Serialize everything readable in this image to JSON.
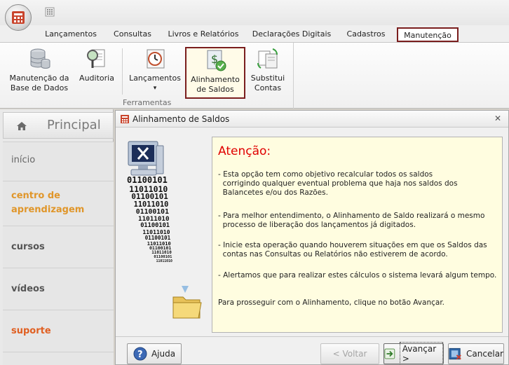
{
  "ribbon_tabs": [
    "Lançamentos",
    "Consultas",
    "Livros e Relatórios",
    "Declarações Digitais",
    "Cadastros",
    "Manutenção"
  ],
  "ribbon_buttons": {
    "manutencao_base": [
      "Manutenção da",
      "Base de Dados"
    ],
    "auditoria": "Auditoria",
    "lancamentos": "Lançamentos",
    "alinhamento": [
      "Alinhamento",
      "de Saldos"
    ],
    "substitui": [
      "Substitui",
      "Contas"
    ],
    "group_label": "Ferramentas",
    "dropdown_glyph": "▾"
  },
  "sidebar": {
    "title": "Principal",
    "items": [
      {
        "label": "início",
        "color": "#666666",
        "bold": false
      },
      {
        "label": "centro de aprendizagem",
        "color": "#e0962a",
        "bold": true
      },
      {
        "label": "cursos",
        "color": "#555555",
        "bold": true
      },
      {
        "label": "vídeos",
        "color": "#555555",
        "bold": true
      },
      {
        "label": "suporte",
        "color": "#e05f21",
        "bold": true
      }
    ]
  },
  "dialog": {
    "title": "Alinhamento de Saldos",
    "close_glyph": "✕",
    "attention": "Atenção:",
    "paragraphs": [
      [
        "- Esta opção tem como objetivo recalcular todos os saldos",
        "  corrigindo qualquer eventual problema que haja nos saldos dos",
        "  Balancetes e/ou dos Razões."
      ],
      [
        "- Para melhor entendimento, o Alinhamento de Saldo realizará o mesmo",
        "  processo de liberação dos lançamentos já digitados."
      ],
      [
        "- Inicie esta operação quando houverem situações em que os Saldos das",
        "  contas nas Consultas ou Relatórios não estiverem de acordo."
      ],
      [
        "- Alertamos que para realizar estes cálculos o sistema levará algum tempo."
      ],
      [
        "Para prosseguir com o Alinhamento, clique no botão Avançar."
      ]
    ],
    "binary_lines": [
      "01100101",
      "11011010",
      "01100101",
      "11011010",
      "01100101",
      "11011010",
      "01100101",
      "11011010",
      "01100101",
      "11011010",
      "01100101",
      "11011010",
      "01100101",
      "11011010"
    ],
    "buttons": {
      "help": "Ajuda",
      "back": "< Voltar",
      "next": "Avançar >",
      "cancel": "Cancelar"
    }
  },
  "colors": {
    "highlight_border": "#7a1e1e",
    "attention": "#e00000",
    "panel_bg": "#fffde0"
  }
}
